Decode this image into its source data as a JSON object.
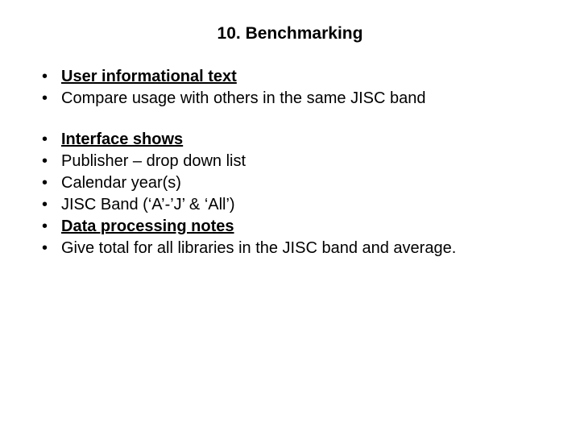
{
  "title": "10. Benchmarking",
  "group1": {
    "i0": "User informational text",
    "i1": "Compare usage with others in the same JISC band"
  },
  "group2": {
    "i0": "Interface shows",
    "i1": "Publisher – drop down list",
    "i2": "Calendar year(s)",
    "i3": "JISC Band (‘A’-’J’ & ‘All’)",
    "i4": "Data processing notes",
    "i5": "Give total for all libraries in the JISC band and average."
  }
}
